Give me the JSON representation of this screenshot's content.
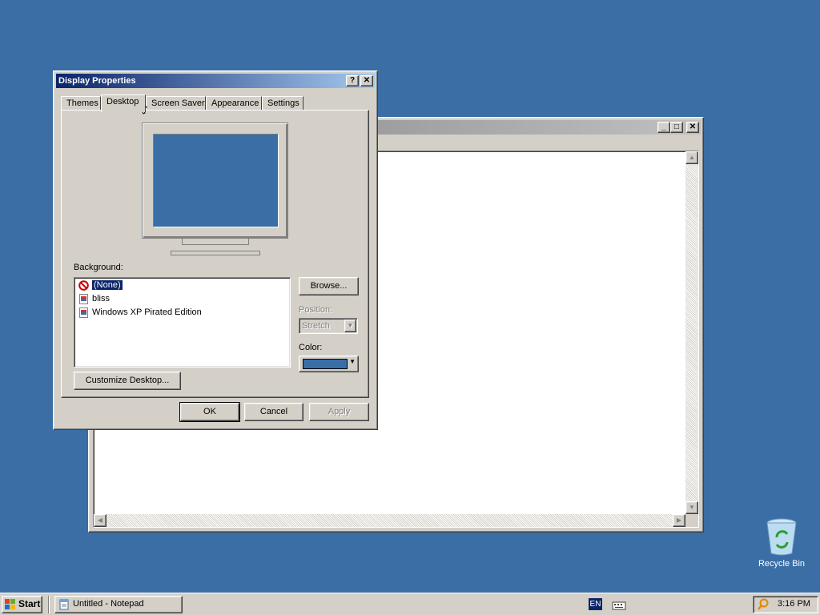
{
  "dialog": {
    "title": "Display Properties",
    "help_button": "?",
    "close_button": "✕",
    "tabs": [
      {
        "label": "Themes",
        "selected": false
      },
      {
        "label": "Desktop",
        "selected": true
      },
      {
        "label": "Screen Saver",
        "selected": false
      },
      {
        "label": "Appearance",
        "selected": false
      },
      {
        "label": "Settings",
        "selected": false
      }
    ],
    "background_label": "Background:",
    "backgrounds": [
      {
        "label": "(None)",
        "icon": "none-icon",
        "selected": true
      },
      {
        "label": "bliss",
        "icon": "image-file-icon",
        "selected": false
      },
      {
        "label": "Windows XP Pirated Edition",
        "icon": "image-file-icon",
        "selected": false
      }
    ],
    "browse_button": "Browse...",
    "position_label": "Position:",
    "position_value": "Stretch",
    "color_label": "Color:",
    "color_value": "#3a6ea5",
    "customize_button": "Customize Desktop...",
    "ok_button": "OK",
    "cancel_button": "Cancel",
    "apply_button": "Apply"
  },
  "notepad": {
    "title": "",
    "minimize": "_",
    "maximize": "□",
    "close": "✕"
  },
  "desktop": {
    "background_color": "#3a6ea5",
    "recycle_bin_label": "Recycle Bin"
  },
  "taskbar": {
    "start_label": "Start",
    "tasks": [
      {
        "label": "Untitled - Notepad"
      }
    ],
    "language": "EN",
    "clock": "3:16 PM"
  }
}
